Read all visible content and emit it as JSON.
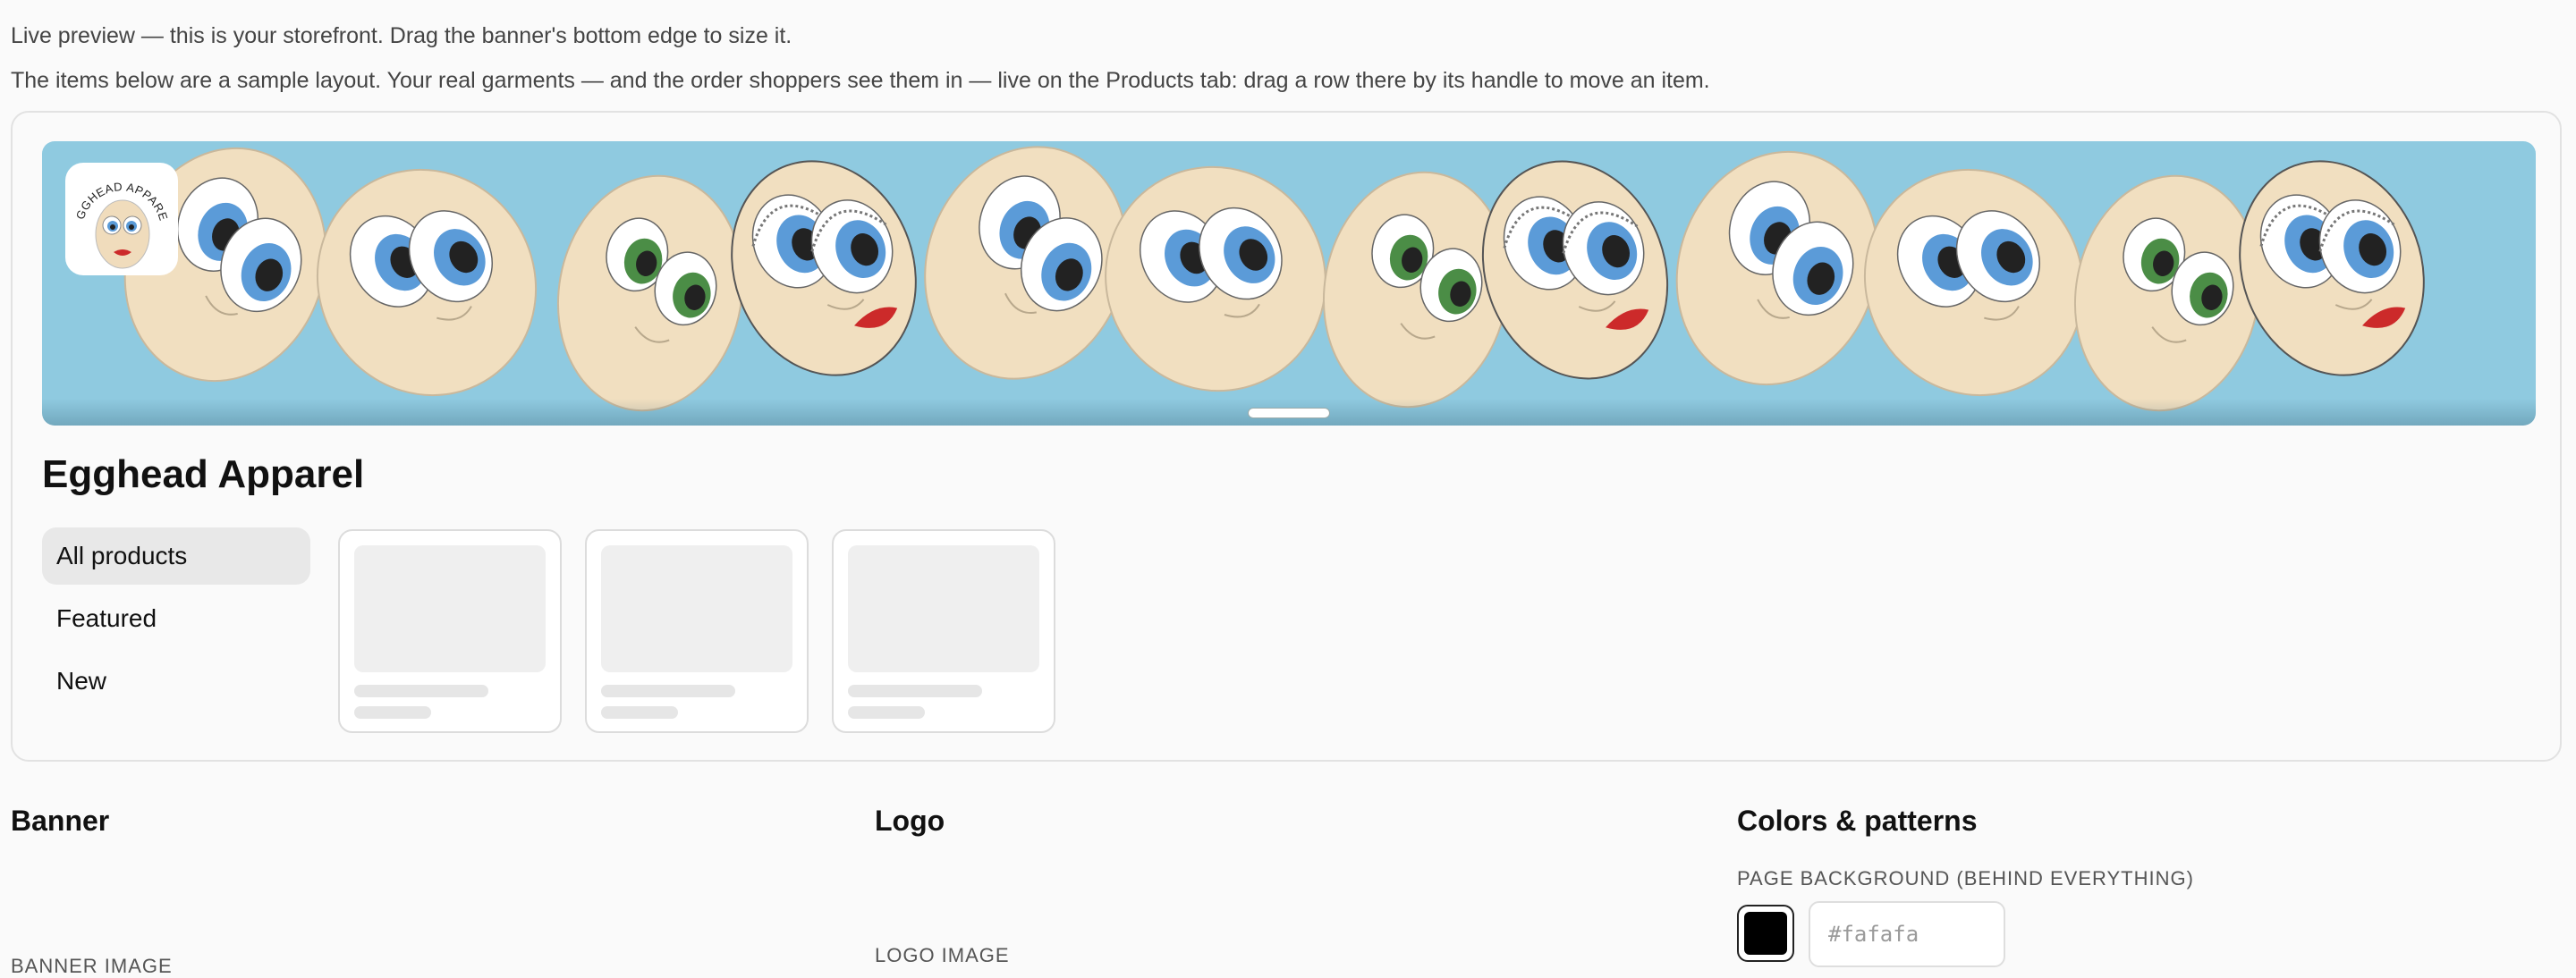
{
  "hints": {
    "line1": "Live preview — this is your storefront. Drag the banner's bottom edge to size it.",
    "line2": "The items below are a sample layout. Your real garments — and the order shoppers see them in — live on the Products tab: drag a row there by its handle to move an item."
  },
  "banner": {
    "background_color": "#8fcae0",
    "logo_text": "EGGHEAD APPAREL",
    "pattern": "egg-faces"
  },
  "store": {
    "name": "Egghead Apparel"
  },
  "nav": {
    "items": [
      {
        "label": "All products",
        "active": true
      },
      {
        "label": "Featured",
        "active": false
      },
      {
        "label": "New",
        "active": false
      }
    ]
  },
  "sample_cards": {
    "count": 3
  },
  "settings": {
    "banner": {
      "title": "Banner",
      "image_label": "BANNER IMAGE"
    },
    "logo": {
      "title": "Logo",
      "image_label": "LOGO IMAGE"
    },
    "colors": {
      "title": "Colors & patterns",
      "page_bg_label": "PAGE BACKGROUND (BEHIND EVERYTHING)",
      "page_bg_value": "",
      "page_bg_placeholder": "#fafafa",
      "swatch_color": "#000000"
    }
  }
}
